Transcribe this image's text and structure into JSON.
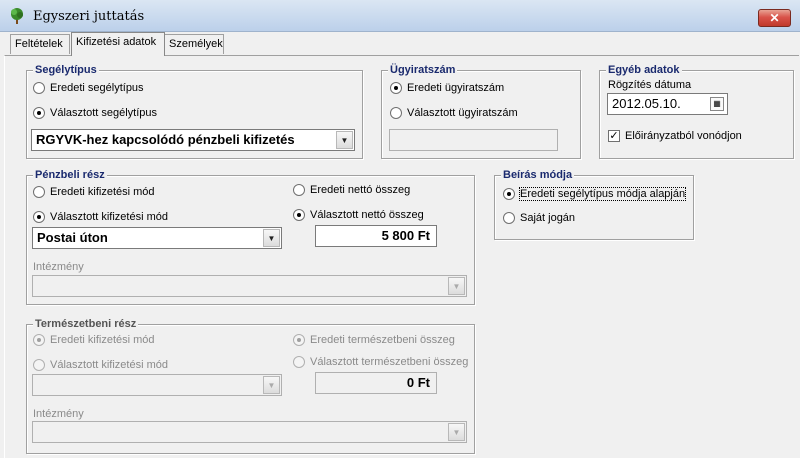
{
  "window": {
    "title": "Egyszeri juttatás",
    "close_label": "✕"
  },
  "tabs": [
    {
      "label": "Feltételek"
    },
    {
      "label": "Kifizetési adatok"
    },
    {
      "label": "Személyek"
    }
  ],
  "segelytipus": {
    "title": "Segélytípus",
    "opt_original": "Eredeti segélytípus",
    "opt_selected": "Választott segélytípus",
    "dropdown_value": "RGYVK-hez kapcsolódó pénzbeli kifizetés"
  },
  "ugyiratszam": {
    "title": "Ügyiratszám",
    "opt_original": "Eredeti ügyiratszám",
    "opt_selected": "Választott ügyiratszám",
    "input_value": ""
  },
  "egyeb": {
    "title": "Egyéb adatok",
    "date_label": "Rögzítés dátuma",
    "date_value": "2012.05.10.",
    "checkbox_label": "Előirányzatból vonódjon",
    "checkbox_mark": "✓"
  },
  "penzbeli": {
    "title": "Pénzbeli rész",
    "opt_orig_mode": "Eredeti kifizetési mód",
    "opt_sel_mode": "Választott kifizetési mód",
    "mode_value": "Postai úton",
    "opt_orig_net": "Eredeti nettó összeg",
    "opt_sel_net": "Választott nettó összeg",
    "amount": "5 800 Ft",
    "institution_label": "Intézmény",
    "institution_value": ""
  },
  "beiras": {
    "title": "Beírás módja",
    "opt_original": "Eredeti segélytípus módja alapján",
    "opt_own": "Saját jogán"
  },
  "termeszetbeni": {
    "title": "Természetbeni rész",
    "opt_orig_mode": "Eredeti kifizetési mód",
    "opt_sel_mode": "Választott kifizetési mód",
    "mode_value": "",
    "opt_orig_amount": "Eredeti természetbeni összeg",
    "opt_sel_amount": "Választott természetbeni összeg",
    "amount": "0 Ft",
    "institution_label": "Intézmény",
    "institution_value": ""
  },
  "icons": {
    "app": "tree-icon",
    "dropdown_arrow": "▼",
    "calendar": "calendar-icon"
  },
  "colors": {
    "group_title": "#1a2a6e",
    "close_button": "#c0392b"
  }
}
